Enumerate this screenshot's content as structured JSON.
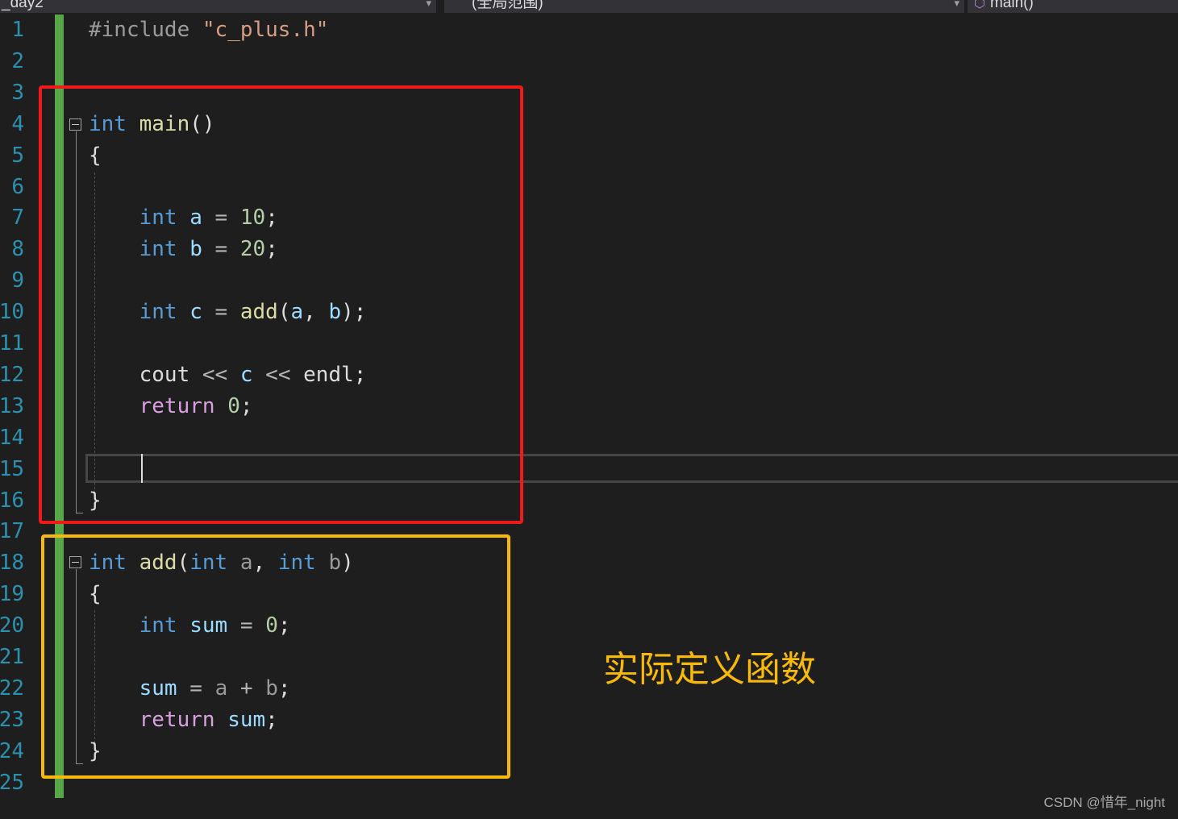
{
  "navbar": {
    "project": "_day2",
    "scope": "(全局范围)",
    "function": "main()",
    "function_icon": "method-cube-icon"
  },
  "editor": {
    "line_numbers": [
      "1",
      "2",
      "3",
      "4",
      "5",
      "6",
      "7",
      "8",
      "9",
      "10",
      "11",
      "12",
      "13",
      "14",
      "15",
      "16",
      "17",
      "18",
      "19",
      "20",
      "21",
      "22",
      "23",
      "24",
      "25"
    ],
    "current_line": 15,
    "lines": [
      {
        "n": 1,
        "tokens": [
          [
            "pre",
            "#include "
          ],
          [
            "str",
            "\"c_plus.h\""
          ]
        ]
      },
      {
        "n": 4,
        "tokens": [
          [
            "kw",
            "int"
          ],
          [
            "plain",
            " "
          ],
          [
            "fn",
            "main"
          ],
          [
            "plain",
            "()"
          ]
        ]
      },
      {
        "n": 5,
        "tokens": [
          [
            "plain",
            "{"
          ]
        ]
      },
      {
        "n": 7,
        "tokens": [
          [
            "plain",
            "    "
          ],
          [
            "kw",
            "int"
          ],
          [
            "plain",
            " "
          ],
          [
            "var",
            "a"
          ],
          [
            "op",
            " = "
          ],
          [
            "num",
            "10"
          ],
          [
            "plain",
            ";"
          ]
        ]
      },
      {
        "n": 8,
        "tokens": [
          [
            "plain",
            "    "
          ],
          [
            "kw",
            "int"
          ],
          [
            "plain",
            " "
          ],
          [
            "var",
            "b"
          ],
          [
            "op",
            " = "
          ],
          [
            "num",
            "20"
          ],
          [
            "plain",
            ";"
          ]
        ]
      },
      {
        "n": 10,
        "tokens": [
          [
            "plain",
            "    "
          ],
          [
            "kw",
            "int"
          ],
          [
            "plain",
            " "
          ],
          [
            "var",
            "c"
          ],
          [
            "op",
            " = "
          ],
          [
            "fn",
            "add"
          ],
          [
            "plain",
            "("
          ],
          [
            "var",
            "a"
          ],
          [
            "plain",
            ", "
          ],
          [
            "var",
            "b"
          ],
          [
            "plain",
            ");"
          ]
        ]
      },
      {
        "n": 12,
        "tokens": [
          [
            "plain",
            "    cout "
          ],
          [
            "op",
            "<<"
          ],
          [
            "plain",
            " "
          ],
          [
            "var",
            "c"
          ],
          [
            "plain",
            " "
          ],
          [
            "op",
            "<<"
          ],
          [
            "plain",
            " endl;"
          ]
        ]
      },
      {
        "n": 13,
        "tokens": [
          [
            "plain",
            "    "
          ],
          [
            "kw2",
            "return"
          ],
          [
            "plain",
            " "
          ],
          [
            "num",
            "0"
          ],
          [
            "plain",
            ";"
          ]
        ]
      },
      {
        "n": 16,
        "tokens": [
          [
            "plain",
            "}"
          ]
        ]
      },
      {
        "n": 18,
        "tokens": [
          [
            "kw",
            "int"
          ],
          [
            "plain",
            " "
          ],
          [
            "fn",
            "add"
          ],
          [
            "plain",
            "("
          ],
          [
            "kw",
            "int"
          ],
          [
            "plain",
            " "
          ],
          [
            "prm",
            "a"
          ],
          [
            "plain",
            ", "
          ],
          [
            "kw",
            "int"
          ],
          [
            "plain",
            " "
          ],
          [
            "prm",
            "b"
          ],
          [
            "plain",
            ")"
          ]
        ]
      },
      {
        "n": 19,
        "tokens": [
          [
            "plain",
            "{"
          ]
        ]
      },
      {
        "n": 20,
        "tokens": [
          [
            "plain",
            "    "
          ],
          [
            "kw",
            "int"
          ],
          [
            "plain",
            " "
          ],
          [
            "var",
            "sum"
          ],
          [
            "op",
            " = "
          ],
          [
            "num",
            "0"
          ],
          [
            "plain",
            ";"
          ]
        ]
      },
      {
        "n": 22,
        "tokens": [
          [
            "plain",
            "    "
          ],
          [
            "var",
            "sum"
          ],
          [
            "op",
            " = "
          ],
          [
            "prm",
            "a"
          ],
          [
            "op",
            " + "
          ],
          [
            "prm",
            "b"
          ],
          [
            "plain",
            ";"
          ]
        ]
      },
      {
        "n": 23,
        "tokens": [
          [
            "plain",
            "    "
          ],
          [
            "kw2",
            "return"
          ],
          [
            "plain",
            " "
          ],
          [
            "var",
            "sum"
          ],
          [
            "plain",
            ";"
          ]
        ]
      },
      {
        "n": 24,
        "tokens": [
          [
            "plain",
            "}"
          ]
        ]
      }
    ]
  },
  "annotation": {
    "text": "实际定义函数",
    "color": "#f8b90b"
  },
  "highlight_colors": {
    "main_box": "#f11a1a",
    "add_box": "#f8b90b"
  },
  "watermark": "CSDN @惜年_night"
}
